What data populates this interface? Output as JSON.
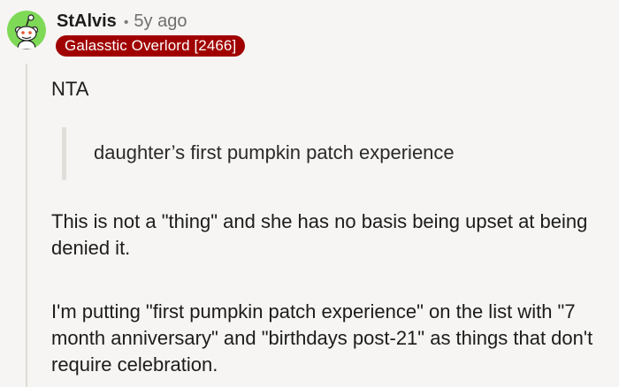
{
  "comment": {
    "author": "StAlvis",
    "separator": "•",
    "age": "5y ago",
    "flair": "Galasstic Overlord [2466]",
    "body": {
      "verdict": "NTA",
      "quote": "daughter’s first pumpkin patch experience",
      "paragraph_1": "This is not a \"thing\" and she has no basis being upset at being denied it.",
      "paragraph_2": "I'm putting \"first pumpkin patch experience\" on the list with \"7 month anniversary\" and \"birthdays post-21\" as things that don't require celebration."
    }
  },
  "colors": {
    "background": "#f6f5f3",
    "flair_background": "#a00000",
    "avatar_background": "#7ed957",
    "text": "#1c1c1c",
    "muted_text": "#6f6f6f",
    "thread_line": "#dedcd8",
    "quote_bar": "#e1deda"
  },
  "icons": {
    "avatar": "snoo-avatar-icon"
  }
}
